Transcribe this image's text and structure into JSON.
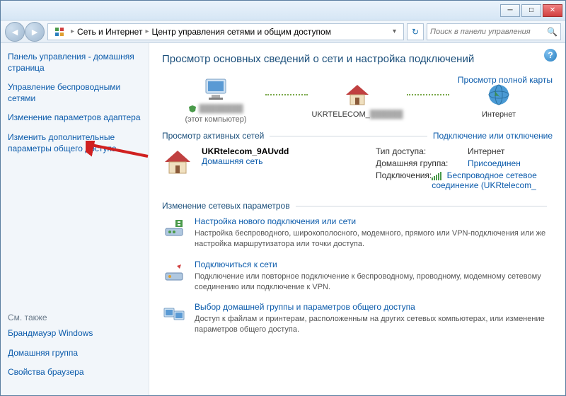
{
  "titlebar": {
    "minimize": "─",
    "maximize": "□",
    "close": "✕"
  },
  "breadcrumb": {
    "part1": "Сеть и Интернет",
    "part2": "Центр управления сетями и общим доступом"
  },
  "search": {
    "placeholder": "Поиск в панели управления"
  },
  "sidebar": {
    "items": [
      "Панель управления - домашняя страница",
      "Управление беспроводными сетями",
      "Изменение параметров адаптера",
      "Изменить дополнительные параметры общего доступа"
    ],
    "seealso_hdr": "См. также",
    "seealso": [
      "Брандмауэр Windows",
      "Домашняя группа",
      "Свойства браузера"
    ]
  },
  "main": {
    "heading": "Просмотр основных сведений о сети и настройка подключений",
    "map_full": "Просмотр полной карты",
    "nodes": {
      "pc_blur": "████████",
      "pc_sub": "(этот компьютер)",
      "router": "UKRTELECOM_",
      "router_blur": "██████",
      "internet": "Интернет"
    },
    "active_hdr": "Просмотр активных сетей",
    "active_link": "Подключение или отключение",
    "active": {
      "name": "UKRtelecom_9AUvdd",
      "type": "Домашняя сеть",
      "access_k": "Тип доступа:",
      "access_v": "Интернет",
      "group_k": "Домашняя группа:",
      "group_v": "Присоединен",
      "conn_k": "Подключения:",
      "conn_v": "Беспроводное сетевое соединение (UKRtelecom_"
    },
    "change_hdr": "Изменение сетевых параметров",
    "tasks": [
      {
        "title": "Настройка нового подключения или сети",
        "desc": "Настройка беспроводного, широкополосного, модемного, прямого или VPN-подключения или же настройка маршрутизатора или точки доступа."
      },
      {
        "title": "Подключиться к сети",
        "desc": "Подключение или повторное подключение к беспроводному, проводному, модемному сетевому соединению или подключение к VPN."
      },
      {
        "title": "Выбор домашней группы и параметров общего доступа",
        "desc": "Доступ к файлам и принтерам, расположенным на других сетевых компьютерах, или изменение параметров общего доступа."
      }
    ]
  }
}
